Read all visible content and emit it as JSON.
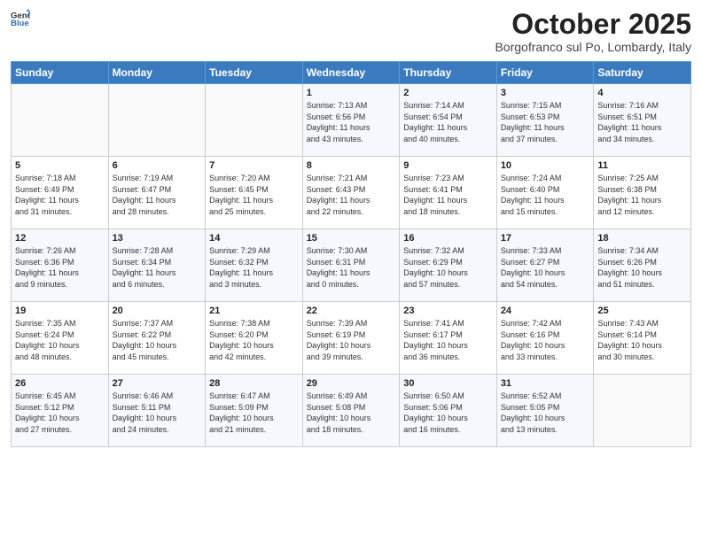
{
  "header": {
    "logo_general": "General",
    "logo_blue": "Blue",
    "month": "October 2025",
    "location": "Borgofranco sul Po, Lombardy, Italy"
  },
  "weekdays": [
    "Sunday",
    "Monday",
    "Tuesday",
    "Wednesday",
    "Thursday",
    "Friday",
    "Saturday"
  ],
  "weeks": [
    [
      {
        "day": "",
        "text": ""
      },
      {
        "day": "",
        "text": ""
      },
      {
        "day": "",
        "text": ""
      },
      {
        "day": "1",
        "text": "Sunrise: 7:13 AM\nSunset: 6:56 PM\nDaylight: 11 hours\nand 43 minutes."
      },
      {
        "day": "2",
        "text": "Sunrise: 7:14 AM\nSunset: 6:54 PM\nDaylight: 11 hours\nand 40 minutes."
      },
      {
        "day": "3",
        "text": "Sunrise: 7:15 AM\nSunset: 6:53 PM\nDaylight: 11 hours\nand 37 minutes."
      },
      {
        "day": "4",
        "text": "Sunrise: 7:16 AM\nSunset: 6:51 PM\nDaylight: 11 hours\nand 34 minutes."
      }
    ],
    [
      {
        "day": "5",
        "text": "Sunrise: 7:18 AM\nSunset: 6:49 PM\nDaylight: 11 hours\nand 31 minutes."
      },
      {
        "day": "6",
        "text": "Sunrise: 7:19 AM\nSunset: 6:47 PM\nDaylight: 11 hours\nand 28 minutes."
      },
      {
        "day": "7",
        "text": "Sunrise: 7:20 AM\nSunset: 6:45 PM\nDaylight: 11 hours\nand 25 minutes."
      },
      {
        "day": "8",
        "text": "Sunrise: 7:21 AM\nSunset: 6:43 PM\nDaylight: 11 hours\nand 22 minutes."
      },
      {
        "day": "9",
        "text": "Sunrise: 7:23 AM\nSunset: 6:41 PM\nDaylight: 11 hours\nand 18 minutes."
      },
      {
        "day": "10",
        "text": "Sunrise: 7:24 AM\nSunset: 6:40 PM\nDaylight: 11 hours\nand 15 minutes."
      },
      {
        "day": "11",
        "text": "Sunrise: 7:25 AM\nSunset: 6:38 PM\nDaylight: 11 hours\nand 12 minutes."
      }
    ],
    [
      {
        "day": "12",
        "text": "Sunrise: 7:26 AM\nSunset: 6:36 PM\nDaylight: 11 hours\nand 9 minutes."
      },
      {
        "day": "13",
        "text": "Sunrise: 7:28 AM\nSunset: 6:34 PM\nDaylight: 11 hours\nand 6 minutes."
      },
      {
        "day": "14",
        "text": "Sunrise: 7:29 AM\nSunset: 6:32 PM\nDaylight: 11 hours\nand 3 minutes."
      },
      {
        "day": "15",
        "text": "Sunrise: 7:30 AM\nSunset: 6:31 PM\nDaylight: 11 hours\nand 0 minutes."
      },
      {
        "day": "16",
        "text": "Sunrise: 7:32 AM\nSunset: 6:29 PM\nDaylight: 10 hours\nand 57 minutes."
      },
      {
        "day": "17",
        "text": "Sunrise: 7:33 AM\nSunset: 6:27 PM\nDaylight: 10 hours\nand 54 minutes."
      },
      {
        "day": "18",
        "text": "Sunrise: 7:34 AM\nSunset: 6:26 PM\nDaylight: 10 hours\nand 51 minutes."
      }
    ],
    [
      {
        "day": "19",
        "text": "Sunrise: 7:35 AM\nSunset: 6:24 PM\nDaylight: 10 hours\nand 48 minutes."
      },
      {
        "day": "20",
        "text": "Sunrise: 7:37 AM\nSunset: 6:22 PM\nDaylight: 10 hours\nand 45 minutes."
      },
      {
        "day": "21",
        "text": "Sunrise: 7:38 AM\nSunset: 6:20 PM\nDaylight: 10 hours\nand 42 minutes."
      },
      {
        "day": "22",
        "text": "Sunrise: 7:39 AM\nSunset: 6:19 PM\nDaylight: 10 hours\nand 39 minutes."
      },
      {
        "day": "23",
        "text": "Sunrise: 7:41 AM\nSunset: 6:17 PM\nDaylight: 10 hours\nand 36 minutes."
      },
      {
        "day": "24",
        "text": "Sunrise: 7:42 AM\nSunset: 6:16 PM\nDaylight: 10 hours\nand 33 minutes."
      },
      {
        "day": "25",
        "text": "Sunrise: 7:43 AM\nSunset: 6:14 PM\nDaylight: 10 hours\nand 30 minutes."
      }
    ],
    [
      {
        "day": "26",
        "text": "Sunrise: 6:45 AM\nSunset: 5:12 PM\nDaylight: 10 hours\nand 27 minutes."
      },
      {
        "day": "27",
        "text": "Sunrise: 6:46 AM\nSunset: 5:11 PM\nDaylight: 10 hours\nand 24 minutes."
      },
      {
        "day": "28",
        "text": "Sunrise: 6:47 AM\nSunset: 5:09 PM\nDaylight: 10 hours\nand 21 minutes."
      },
      {
        "day": "29",
        "text": "Sunrise: 6:49 AM\nSunset: 5:08 PM\nDaylight: 10 hours\nand 18 minutes."
      },
      {
        "day": "30",
        "text": "Sunrise: 6:50 AM\nSunset: 5:06 PM\nDaylight: 10 hours\nand 16 minutes."
      },
      {
        "day": "31",
        "text": "Sunrise: 6:52 AM\nSunset: 5:05 PM\nDaylight: 10 hours\nand 13 minutes."
      },
      {
        "day": "",
        "text": ""
      }
    ]
  ]
}
